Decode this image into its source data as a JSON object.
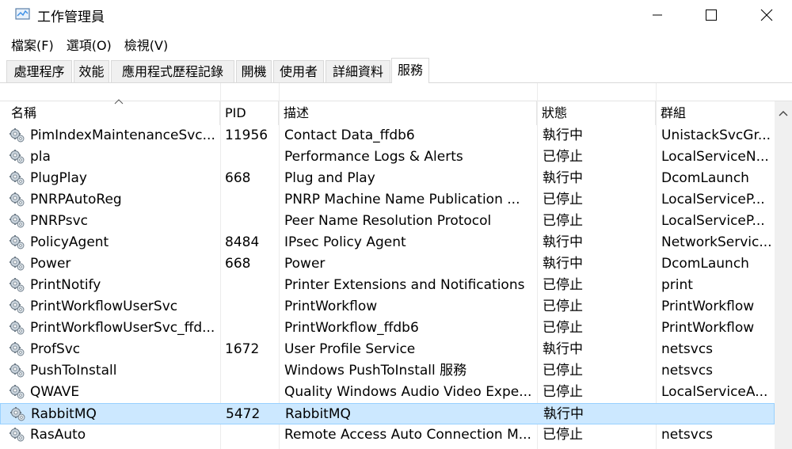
{
  "window": {
    "title": "工作管理員"
  },
  "menu": [
    {
      "label": "檔案(F)"
    },
    {
      "label": "選項(O)"
    },
    {
      "label": "檢視(V)"
    }
  ],
  "tabs": [
    {
      "label": "處理程序"
    },
    {
      "label": "效能"
    },
    {
      "label": "應用程式歷程記錄"
    },
    {
      "label": "開機"
    },
    {
      "label": "使用者"
    },
    {
      "label": "詳細資料"
    },
    {
      "label": "服務",
      "active": true
    }
  ],
  "table": {
    "columns": [
      "名稱",
      "PID",
      "描述",
      "狀態",
      "群組"
    ],
    "sorted_column": "名稱",
    "rows": [
      {
        "name": "PimIndexMaintenanceSvc...",
        "pid": "11956",
        "desc": "Contact Data_ffdb6",
        "status": "執行中",
        "group": "UnistackSvcGr..."
      },
      {
        "name": "pla",
        "pid": "",
        "desc": "Performance Logs & Alerts",
        "status": "已停止",
        "group": "LocalServiceN..."
      },
      {
        "name": "PlugPlay",
        "pid": "668",
        "desc": "Plug and Play",
        "status": "執行中",
        "group": "DcomLaunch"
      },
      {
        "name": "PNRPAutoReg",
        "pid": "",
        "desc": "PNRP Machine Name Publication ...",
        "status": "已停止",
        "group": "LocalServiceP..."
      },
      {
        "name": "PNRPsvc",
        "pid": "",
        "desc": "Peer Name Resolution Protocol",
        "status": "已停止",
        "group": "LocalServiceP..."
      },
      {
        "name": "PolicyAgent",
        "pid": "8484",
        "desc": "IPsec Policy Agent",
        "status": "執行中",
        "group": "NetworkServic..."
      },
      {
        "name": "Power",
        "pid": "668",
        "desc": "Power",
        "status": "執行中",
        "group": "DcomLaunch"
      },
      {
        "name": "PrintNotify",
        "pid": "",
        "desc": "Printer Extensions and Notifications",
        "status": "已停止",
        "group": "print"
      },
      {
        "name": "PrintWorkflowUserSvc",
        "pid": "",
        "desc": "PrintWorkflow",
        "status": "已停止",
        "group": "PrintWorkflow"
      },
      {
        "name": "PrintWorkflowUserSvc_ffd...",
        "pid": "",
        "desc": "PrintWorkflow_ffdb6",
        "status": "已停止",
        "group": "PrintWorkflow"
      },
      {
        "name": "ProfSvc",
        "pid": "1672",
        "desc": "User Profile Service",
        "status": "執行中",
        "group": "netsvcs"
      },
      {
        "name": "PushToInstall",
        "pid": "",
        "desc": "Windows PushToInstall 服務",
        "status": "已停止",
        "group": "netsvcs"
      },
      {
        "name": "QWAVE",
        "pid": "",
        "desc": "Quality Windows Audio Video Expe...",
        "status": "已停止",
        "group": "LocalServiceA..."
      },
      {
        "name": "RabbitMQ",
        "pid": "5472",
        "desc": "RabbitMQ",
        "status": "執行中",
        "group": "",
        "selected": true
      },
      {
        "name": "RasAuto",
        "pid": "",
        "desc": "Remote Access Auto Connection M...",
        "status": "已停止",
        "group": "netsvcs"
      }
    ]
  },
  "colors": {
    "selected_bg": "#cce8ff",
    "selected_border": "#99d1ff",
    "tab_border": "#d9d9d9"
  },
  "icons": {
    "row_icon": "gear-service-icon",
    "app_icon": "task-manager-icon"
  }
}
